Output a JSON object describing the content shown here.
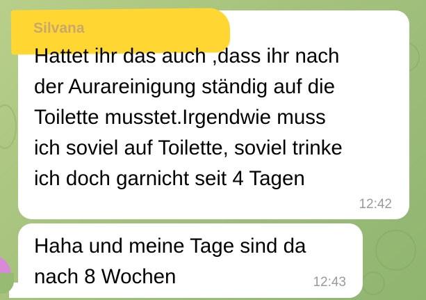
{
  "chat": {
    "background_color": "#a8c47e",
    "bubble_color": "#ffffff",
    "highlight_color": "#ffd632"
  },
  "messages": [
    {
      "sender": "Silvana",
      "text": "Hattet ihr das auch ,dass ihr nach\nder Aurareinigung ständig auf die\nToilette musstet.Irgendwie muss\nich soviel auf Toilette, soviel trinke\nich doch garnicht seit 4 Tagen",
      "time": "12:42"
    },
    {
      "text": "Haha und meine Tage sind da\nnach 8 Wochen",
      "time": "12:43"
    }
  ],
  "avatar": {
    "color": "#d88ad8"
  }
}
